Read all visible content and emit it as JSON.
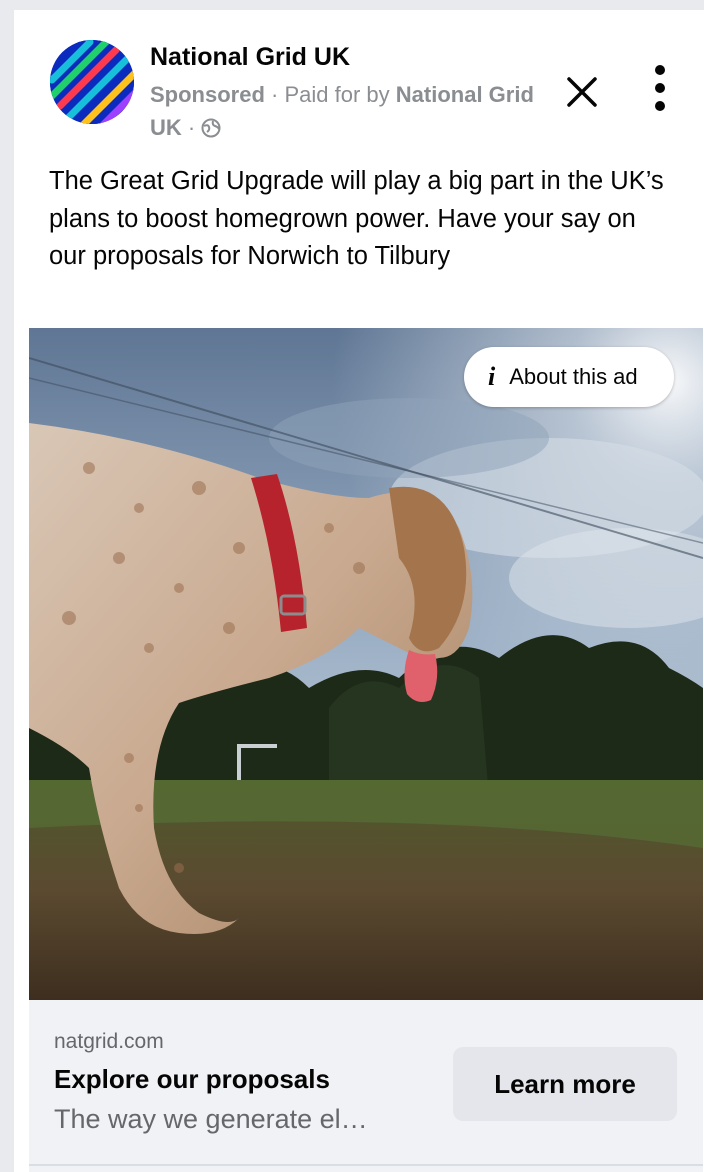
{
  "post": {
    "page_name": "National Grid UK",
    "sponsored_label": "Sponsored",
    "separator": "·",
    "paid_for_prefix": "Paid for by",
    "paid_for_name": "National Grid UK",
    "body_text": "The Great Grid Upgrade will play a big part in the UK’s plans to boost homegrown power. Have your say on our proposals for Norwich to Tilbury",
    "privacy_icon": "globe-icon"
  },
  "header_actions": {
    "close_icon": "close-icon",
    "more_icon": "more-vertical-icon"
  },
  "image": {
    "about_label": "About this ad",
    "info_icon_glyph": "i"
  },
  "link_preview": {
    "domain": "natgrid.com",
    "headline": "Explore our proposals",
    "description": "The way we generate el…",
    "cta_label": "Learn more"
  },
  "colors": {
    "avatar_bg": "#0b2bbf",
    "text_primary": "#050505",
    "text_secondary": "#65676b",
    "meta_gray": "#8a8d91",
    "footer_bg": "#f0f2f5",
    "button_bg": "#e4e6eb"
  }
}
